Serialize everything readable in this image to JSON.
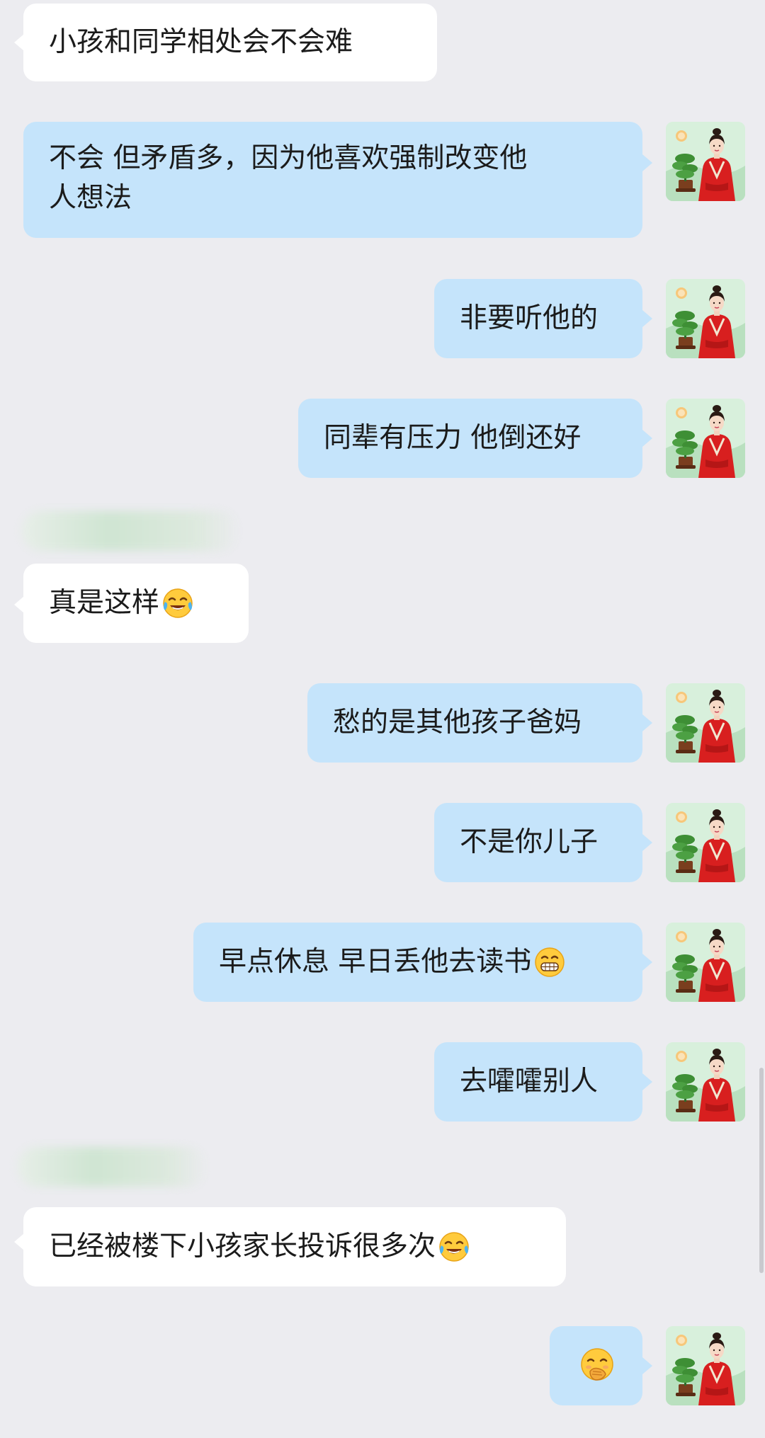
{
  "messages": [
    {
      "side": "in",
      "text": "小孩和同学相处会不会难"
    },
    {
      "side": "out",
      "line1": "不会 但矛盾多，因为他喜欢强制改变他",
      "line2": "人想法"
    },
    {
      "side": "out",
      "text": "非要听他的"
    },
    {
      "side": "out",
      "text": "同辈有压力 他倒还好"
    },
    {
      "side": "in",
      "text": "真是这样",
      "emoji": "tears-of-joy-icon"
    },
    {
      "side": "out",
      "text": "愁的是其他孩子爸妈"
    },
    {
      "side": "out",
      "text": "不是你儿子"
    },
    {
      "side": "out",
      "text": "早点休息 早日丢他去读书",
      "emoji": "grinning-face-icon"
    },
    {
      "side": "out",
      "text": "去嚯嚯别人"
    },
    {
      "side": "in",
      "text": "已经被楼下小孩家长投诉很多次",
      "emoji": "tears-of-joy-icon"
    },
    {
      "side": "out",
      "text": "",
      "emoji": "face-with-hand-over-mouth-icon"
    }
  ],
  "colors": {
    "background": "#ECECF0",
    "incoming_bubble": "#FFFFFF",
    "outgoing_bubble": "#C5E4FB",
    "text": "#1B1B1B"
  },
  "avatar": {
    "icon": "woman-in-red-hanfu-avatar-icon"
  }
}
